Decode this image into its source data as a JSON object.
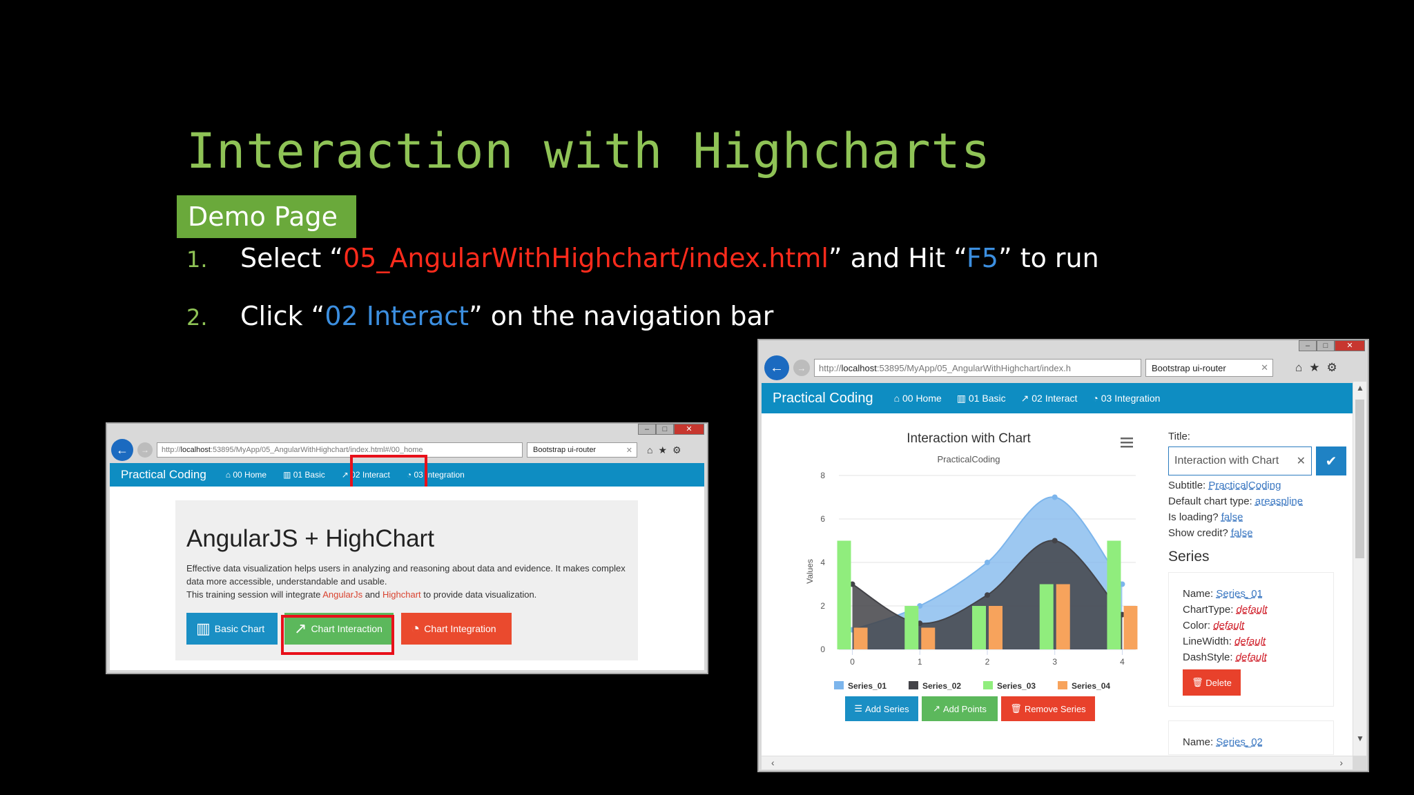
{
  "slide": {
    "title": "Interaction with Highcharts",
    "badge": "Demo Page",
    "steps": [
      {
        "num": "1.",
        "pre": "Select “",
        "hl": "05_AngularWithHighchart/index.html",
        "mid": "” and Hit “",
        "hl2": "F5",
        "post": "” to run"
      },
      {
        "num": "2.",
        "pre": "Click “",
        "hl": "02 Interact",
        "post": "” on the navigation bar"
      }
    ]
  },
  "left_browser": {
    "url_prefix": "http://",
    "url_host": "localhost",
    "url_rest": ":53895/MyApp/05_AngularWithHighchart/index.html#/00_home",
    "tab_label": "Bootstrap ui-router",
    "nav": {
      "brand": "Practical Coding",
      "items": [
        "00 Home",
        "01 Basic",
        "02 Interact",
        "03 Integration"
      ]
    },
    "jumbotron": {
      "heading": "AngularJS + HighChart",
      "para1": "Effective data visualization helps users in analyzing and reasoning about data and evidence. It makes complex data more accessible, understandable and usable.",
      "para2_pre": "This training session will integrate ",
      "para2_link1": "AngularJs",
      "para2_mid": " and ",
      "para2_link2": "Highchart",
      "para2_post": " to provide data visualization."
    },
    "buttons": {
      "basic": "Basic Chart",
      "interaction": "Chart Interaction",
      "integration": "Chart Integration"
    },
    "colors": {
      "basic": "#1a8fc4",
      "interaction": "#5cb85c",
      "integration": "#ea4a2e",
      "highlight": "#e8101a"
    }
  },
  "right_browser": {
    "url_prefix": "http://",
    "url_host": "localhost",
    "url_rest": ":53895/MyApp/05_AngularWithHighchart/index.h",
    "tab_label": "Bootstrap ui-router",
    "nav": {
      "brand": "Practical Coding",
      "items": [
        "00 Home",
        "01 Basic",
        "02 Interact",
        "03 Integration"
      ]
    },
    "panel": {
      "title_label": "Title:",
      "title_value": "Interaction with Chart",
      "subtitle_label": "Subtitle:",
      "subtitle_value": "PracticalCoding",
      "type_label": "Default chart type:",
      "type_value": "areaspline",
      "loading_label": "Is loading?",
      "loading_value": "false",
      "credit_label": "Show credit?",
      "credit_value": "false",
      "series_heading": "Series",
      "series_card": {
        "name_label": "Name:",
        "name_value": "Series_01",
        "type_label": "ChartType:",
        "type_value": "default",
        "color_label": "Color:",
        "color_value": "default",
        "lw_label": "LineWidth:",
        "lw_value": "default",
        "ds_label": "DashStyle:",
        "ds_value": "default",
        "delete_label": "Delete"
      },
      "series_card2": {
        "name_label": "Name:",
        "name_value": "Series_02"
      }
    },
    "buttons": {
      "add_series": "Add Series",
      "add_points": "Add Points",
      "remove_series": "Remove Series"
    }
  },
  "chart_data": {
    "type": "area",
    "title": "Interaction with Chart",
    "subtitle": "PracticalCoding",
    "xlabel": "",
    "ylabel": "Values",
    "x": [
      0,
      1,
      2,
      3,
      4
    ],
    "xlim": [
      -0.2,
      4.2
    ],
    "ylim": [
      0,
      8
    ],
    "yticks": [
      0,
      2,
      4,
      6,
      8
    ],
    "grid": true,
    "legend": "bottom",
    "series": [
      {
        "name": "Series_01",
        "kind": "areaspline",
        "color": "#7cb5ec",
        "values": [
          0.9,
          2.0,
          4.0,
          7.0,
          3.0
        ]
      },
      {
        "name": "Series_02",
        "kind": "areaspline",
        "color": "#434348",
        "values": [
          3.0,
          1.2,
          2.5,
          5.0,
          1.6
        ]
      },
      {
        "name": "Series_03",
        "kind": "column",
        "color": "#90ed7d",
        "values": [
          5.0,
          2.0,
          2.0,
          3.0,
          5.0
        ]
      },
      {
        "name": "Series_04",
        "kind": "column",
        "color": "#f7a35c",
        "values": [
          1.0,
          1.0,
          2.0,
          3.0,
          2.0
        ]
      }
    ]
  }
}
